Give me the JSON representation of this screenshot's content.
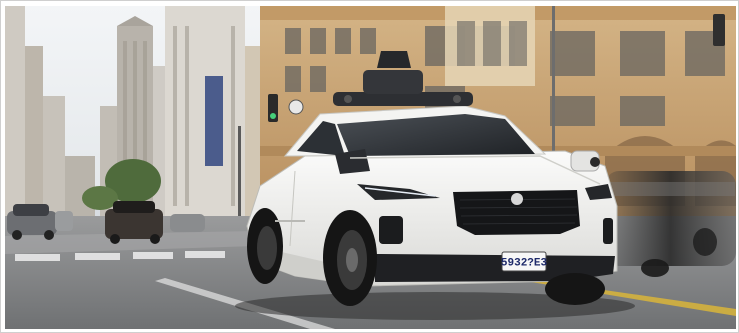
{
  "photo": {
    "plate_text": "5932?E3",
    "colors": {
      "sky": "#eef1f4",
      "building_warm": "#c9a474",
      "building_light": "#d9c29a",
      "road": "#77797b",
      "vehicle_body": "#f3f3f1",
      "lidar_dome": "#2a2c30",
      "tire": "#1c1c1c"
    }
  }
}
